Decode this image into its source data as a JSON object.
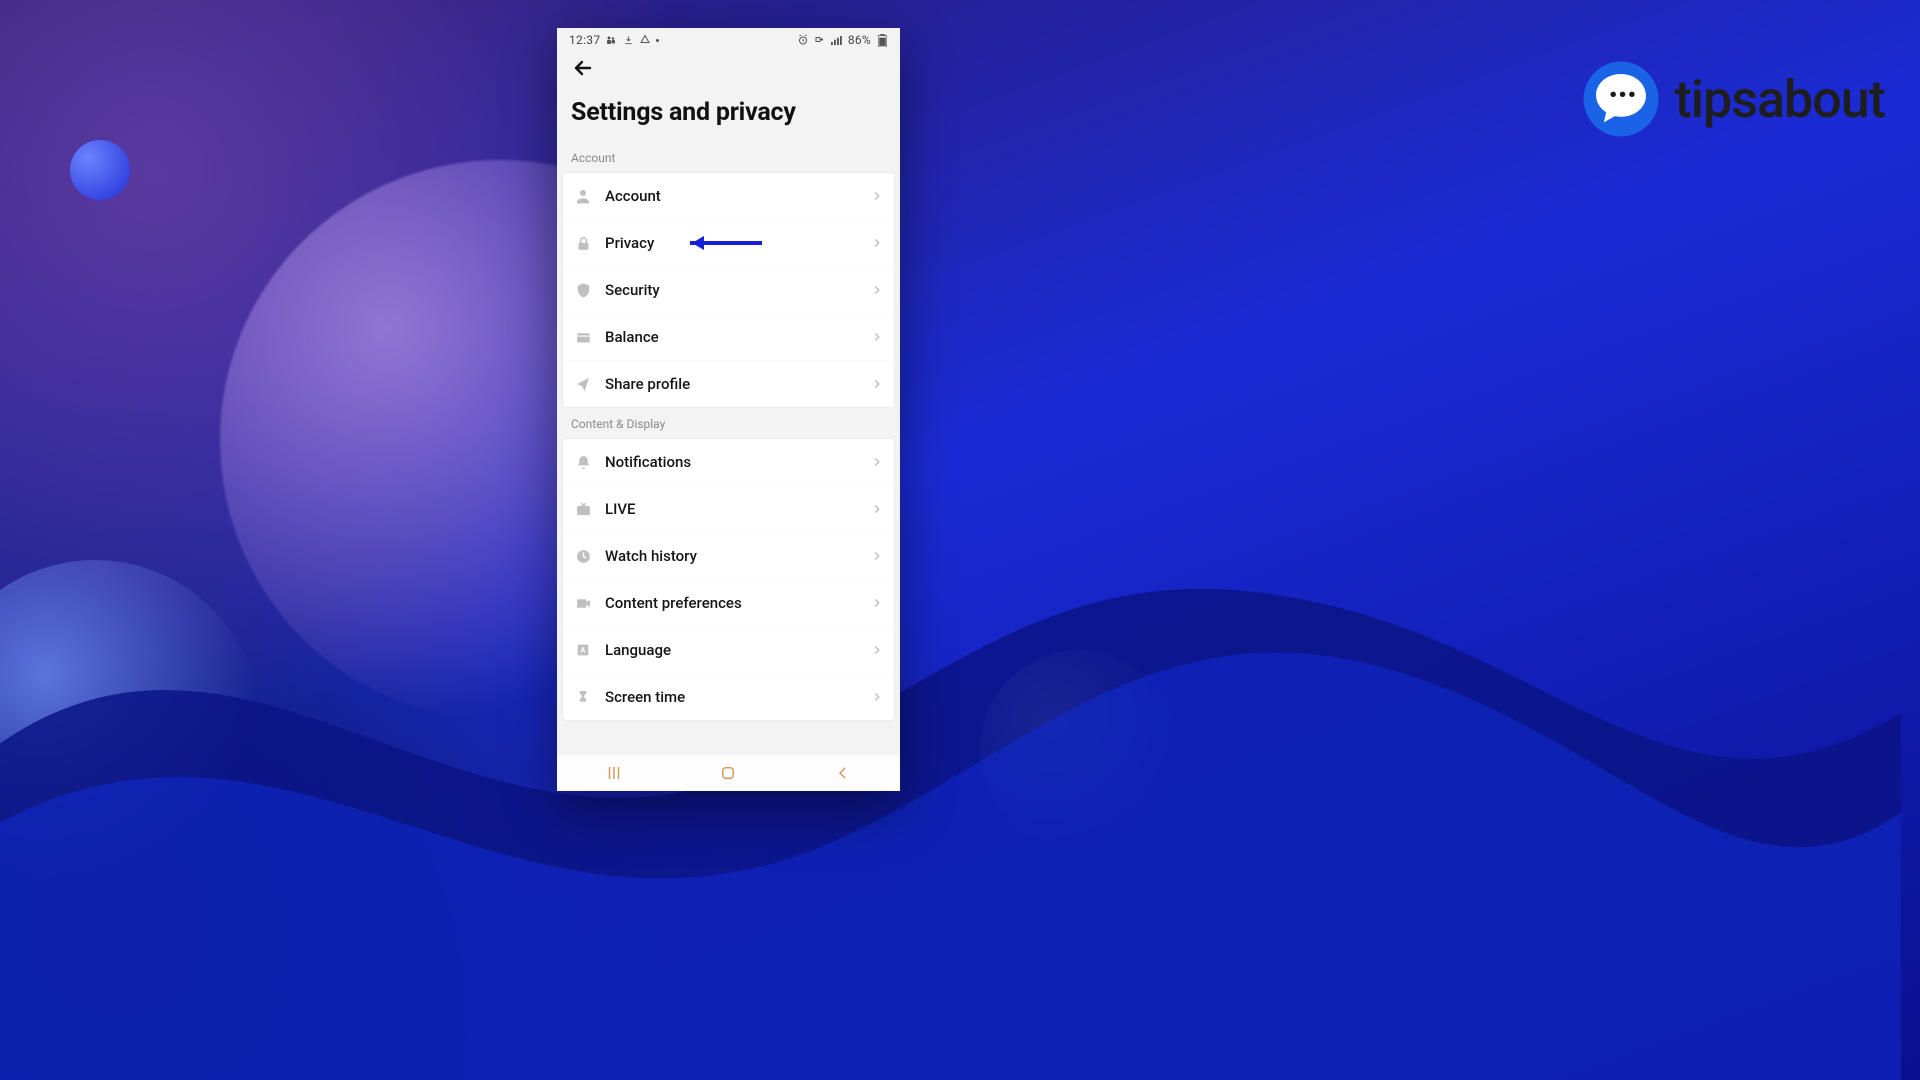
{
  "status": {
    "time": "12:37",
    "battery": "86%"
  },
  "header": {
    "title": "Settings and privacy"
  },
  "sections": {
    "account": {
      "header": "Account",
      "items": [
        {
          "label": "Account"
        },
        {
          "label": "Privacy"
        },
        {
          "label": "Security"
        },
        {
          "label": "Balance"
        },
        {
          "label": "Share profile"
        }
      ]
    },
    "content": {
      "header": "Content & Display",
      "items": [
        {
          "label": "Notifications"
        },
        {
          "label": "LIVE"
        },
        {
          "label": "Watch history"
        },
        {
          "label": "Content preferences"
        },
        {
          "label": "Language"
        },
        {
          "label": "Screen time"
        }
      ]
    }
  },
  "brand": {
    "name": "tipsabout"
  },
  "colors": {
    "arrow": "#1720d8",
    "nav": "#d39a62",
    "brand_accent": "#1a62e6"
  }
}
